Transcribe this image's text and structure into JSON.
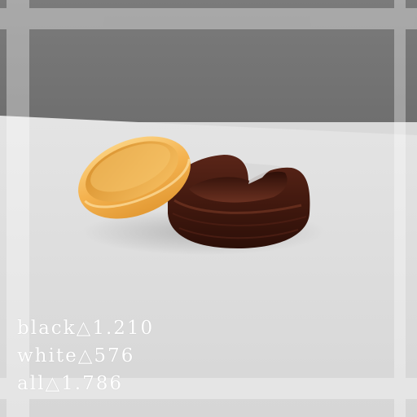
{
  "stats": [
    {
      "label": "black",
      "symbol": "△",
      "value": "1.210"
    },
    {
      "label": "white",
      "symbol": "△",
      "value": "576"
    },
    {
      "label": "all",
      "symbol": "△",
      "value": "1.786"
    }
  ],
  "scene": {
    "objects": [
      {
        "name": "gold-ring",
        "color": "#f2b24e"
      },
      {
        "name": "brown-cuff-ring",
        "color": "#4a1d12"
      }
    ],
    "colors": {
      "wall": "#777777",
      "floor": "#dedede",
      "overlay_lines": "#e6e6e6"
    }
  }
}
